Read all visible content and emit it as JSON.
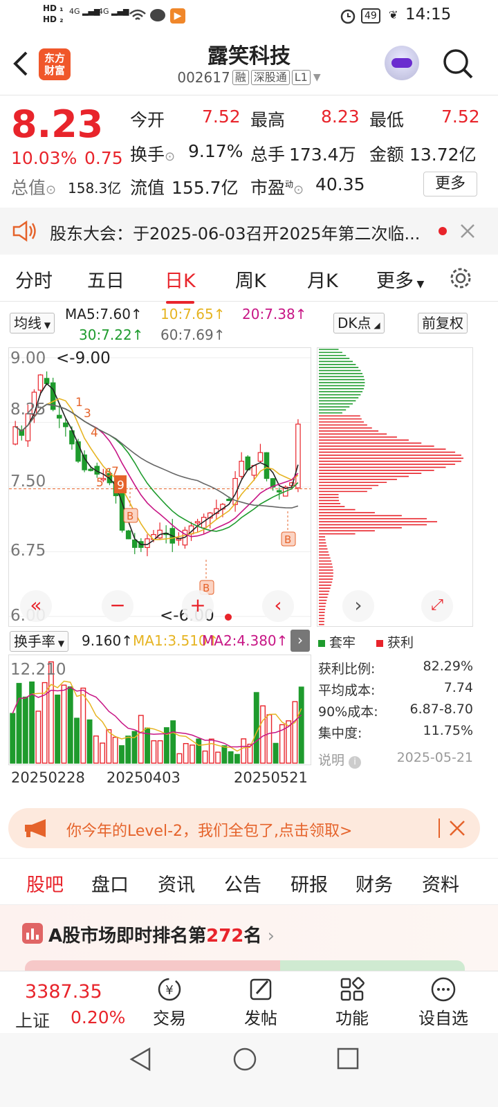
{
  "status": {
    "time": "14:15",
    "battery": "49",
    "sim1": "HD",
    "sim2": "HD",
    "net1": "4G",
    "net2": "4G"
  },
  "header": {
    "logo_line1": "东方",
    "logo_line2": "财富",
    "title": "露笑科技",
    "code": "002617",
    "tags": [
      "融",
      "深股通",
      "L1"
    ]
  },
  "quote": {
    "price": "8.23",
    "change_pct": "10.03%",
    "change": "0.75",
    "open_label": "今开",
    "open": "7.52",
    "high_label": "最高",
    "high": "8.23",
    "low_label": "最低",
    "low": "7.52",
    "turnover_label": "换手",
    "turnover": "9.17%",
    "volume_label": "总手",
    "volume": "173.4万",
    "amount_label": "金额",
    "amount": "13.72亿",
    "mcap_label": "总值",
    "mcap": "158.3亿",
    "float_label": "流值",
    "float": "155.7亿",
    "pe_label": "市盈",
    "pe_sup": "动",
    "pe": "40.35",
    "more": "更多"
  },
  "notice": {
    "text": "股东大会：于2025-06-03召开2025年第二次临..."
  },
  "periods": {
    "tabs": [
      "分时",
      "五日",
      "日K",
      "周K",
      "月K",
      "更多"
    ],
    "active": "日K"
  },
  "ma": {
    "selector": "均线",
    "ma5": "MA5:7.60↑",
    "ma10": "10:7.65↑",
    "ma20": "20:7.38↑",
    "ma30": "30:7.22↑",
    "ma60": "60:7.69↑",
    "dk": "DK点",
    "adjust": "前复权",
    "colors": {
      "ma5": "#222222",
      "ma10": "#e6b422",
      "ma20": "#c71585",
      "ma30": "#1e9b2d",
      "ma60": "#666666"
    }
  },
  "kchart": {
    "y_ticks": [
      "9.00",
      "8.25",
      "7.50",
      "6.75",
      "6.00"
    ],
    "max_label": "<-9.00",
    "min_label": "<-6.00",
    "markers": [
      "1",
      "3",
      "4",
      "5",
      "6",
      "7",
      "8",
      "9"
    ],
    "buy_label": "B"
  },
  "volume": {
    "selector": "换手率",
    "value": "9.160↑",
    "ma1": "MA1:3.510↑",
    "ma2": "MA2:4.380↑",
    "max": "12.210",
    "dates": [
      "20250228",
      "20250403",
      "20250521"
    ]
  },
  "chips": {
    "legend_trapped": "套牢",
    "legend_profit": "获利",
    "rows": [
      {
        "label": "获利比例:",
        "value": "82.29%"
      },
      {
        "label": "平均成本:",
        "value": "7.74"
      },
      {
        "label": "90%成本:",
        "value": "6.87-8.70"
      },
      {
        "label": "集中度:",
        "value": "11.75%"
      }
    ],
    "note": "说明",
    "date": "2025-05-21"
  },
  "promo": {
    "text": "你今年的Level-2，我们全包了,点击领取>"
  },
  "content_tabs": {
    "tabs": [
      "股吧",
      "盘口",
      "资讯",
      "公告",
      "研报",
      "财务",
      "资料"
    ],
    "active": "股吧"
  },
  "rank": {
    "prefix": "A股市场即时排名第",
    "number": "272",
    "suffix": "名"
  },
  "bottom": {
    "index_value": "3387.35",
    "index_name": "上证",
    "index_pct": "0.20%",
    "items": [
      "交易",
      "发帖",
      "功能",
      "设自选"
    ]
  },
  "colors": {
    "up": "#e8242b",
    "down": "#1e9b2d",
    "accent": "#f0572a"
  }
}
